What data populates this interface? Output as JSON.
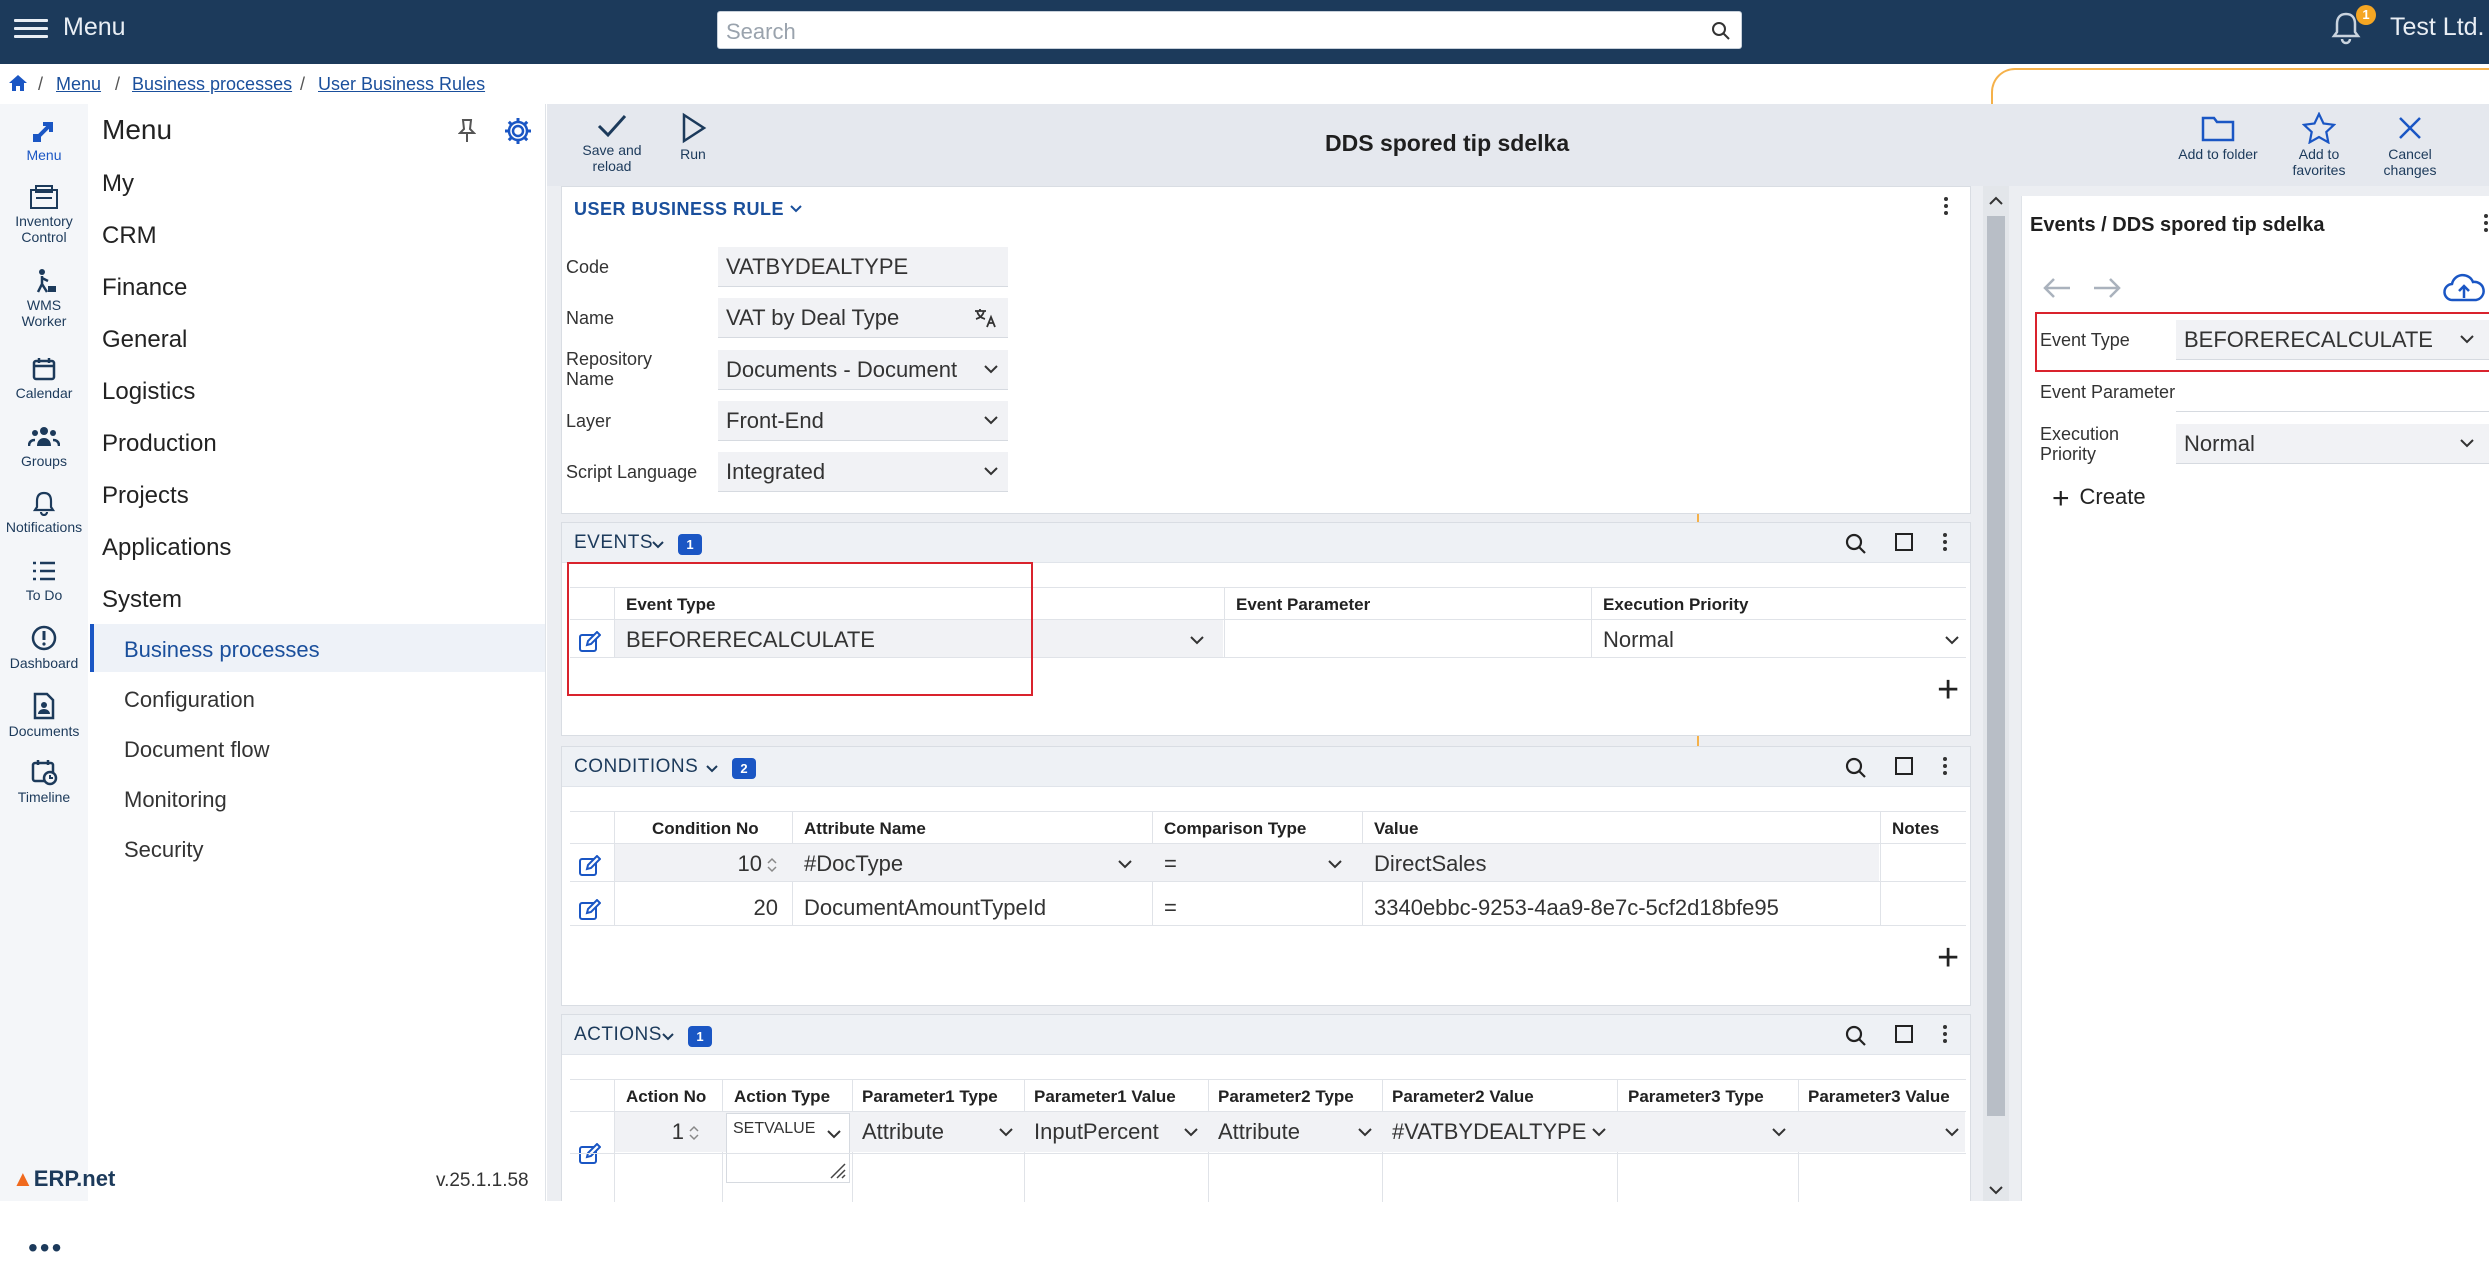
{
  "topbar": {
    "menu_label": "Menu",
    "search_placeholder": "Search",
    "notification_count": "1",
    "company": "Test Ltd."
  },
  "breadcrumb": {
    "items": [
      "Menu",
      "Business processes",
      "User Business Rules"
    ]
  },
  "rail": [
    {
      "label": "Menu",
      "icon": "menu-app-icon"
    },
    {
      "label": "Inventory Control",
      "icon": "inventory-icon"
    },
    {
      "label": "WMS Worker",
      "icon": "worker-icon"
    },
    {
      "label": "Calendar",
      "icon": "calendar-icon"
    },
    {
      "label": "Groups",
      "icon": "groups-icon"
    },
    {
      "label": "Notifications",
      "icon": "bell-icon"
    },
    {
      "label": "To Do",
      "icon": "todo-icon"
    },
    {
      "label": "Dashboard",
      "icon": "dashboard-icon"
    },
    {
      "label": "Documents",
      "icon": "documents-icon"
    },
    {
      "label": "Timeline",
      "icon": "timeline-icon"
    }
  ],
  "sidebar": {
    "title": "Menu",
    "items": [
      "My",
      "CRM",
      "Finance",
      "General",
      "Logistics",
      "Production",
      "Projects",
      "Applications",
      "System"
    ],
    "subitems": [
      "Business processes",
      "Configuration",
      "Document flow",
      "Monitoring",
      "Security"
    ],
    "version": "v.25.1.1.58",
    "logo": "ERP.net"
  },
  "toolbar": {
    "save_reload": "Save and reload",
    "run": "Run",
    "title": "DDS spored tip sdelka",
    "add_folder": "Add to folder",
    "add_favorites": "Add to favorites",
    "cancel_changes": "Cancel changes"
  },
  "rule": {
    "header": "USER BUSINESS RULE",
    "code_label": "Code",
    "code": "VATBYDEALTYPE",
    "name_label": "Name",
    "name": "VAT by Deal Type",
    "repo_label": "Repository Name",
    "repo": "Documents - Document",
    "layer_label": "Layer",
    "layer": "Front-End",
    "script_label": "Script Language",
    "script": "Integrated"
  },
  "events": {
    "header": "EVENTS",
    "count": "1",
    "columns": [
      "Event Type",
      "Event Parameter",
      "Execution Priority"
    ],
    "rows": [
      {
        "type": "BEFORERECALCULATE",
        "param": "",
        "priority": "Normal"
      }
    ]
  },
  "conditions": {
    "header": "CONDITIONS",
    "count": "2",
    "columns": [
      "Condition No",
      "Attribute Name",
      "Comparison Type",
      "Value",
      "Notes"
    ],
    "rows": [
      {
        "no": "10",
        "attr": "#DocType",
        "cmp": "=",
        "value": "DirectSales",
        "notes": ""
      },
      {
        "no": "20",
        "attr": "DocumentAmountTypeId",
        "cmp": "=",
        "value": "3340ebbc-9253-4aa9-8e7c-5cf2d18bfe95",
        "notes": ""
      }
    ]
  },
  "actions": {
    "header": "ACTIONS",
    "count": "1",
    "columns": [
      "Action No",
      "Action Type",
      "Parameter1 Type",
      "Parameter1 Value",
      "Parameter2 Type",
      "Parameter2 Value",
      "Parameter3 Type",
      "Parameter3 Value"
    ],
    "rows": [
      {
        "no": "1",
        "type": "SETVALUE",
        "p1type": "Attribute",
        "p1val": "InputPercent",
        "p2type": "Attribute",
        "p2val": "#VATBYDEALTYPE",
        "p3type": "",
        "p3val": ""
      }
    ]
  },
  "right_panel": {
    "title": "Events / DDS spored tip sdelka",
    "event_type_label": "Event Type",
    "event_type": "BEFORERECALCULATE",
    "event_param_label": "Event Parameter",
    "event_param": "",
    "priority_label": "Execution Priority",
    "priority": "Normal",
    "create": "Create"
  }
}
